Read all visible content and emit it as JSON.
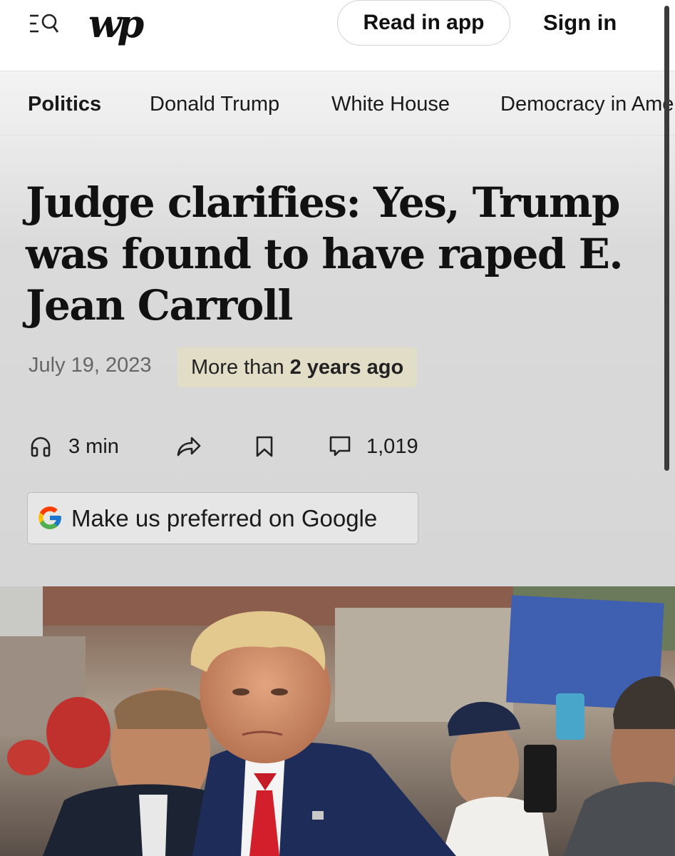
{
  "header": {
    "logo_text": "wp",
    "read_in_app_label": "Read in app",
    "sign_in_label": "Sign in"
  },
  "nav": {
    "items": [
      {
        "label": "Politics",
        "active": true
      },
      {
        "label": "Donald Trump",
        "active": false
      },
      {
        "label": "White House",
        "active": false
      },
      {
        "label": "Democracy in America",
        "active": false
      }
    ]
  },
  "article": {
    "headline": "Judge clarifies: Yes, Trump was found to have raped E. Jean Carroll",
    "date": "July 19, 2023",
    "age_prefix": "More than",
    "age_bold": "2 years ago",
    "listen_time": "3 min",
    "comment_count": "1,019",
    "google_cta": "Make us preferred on Google"
  },
  "icons": {
    "menu": "menu-search-icon",
    "listen": "headphones-icon",
    "share": "share-icon",
    "save": "bookmark-icon",
    "comments": "comment-icon",
    "google": "google-g-icon"
  },
  "colors": {
    "age_badge_bg": "#e2ddc6",
    "nav_bg": "#efefef",
    "content_bg": "#d8d8d8"
  }
}
